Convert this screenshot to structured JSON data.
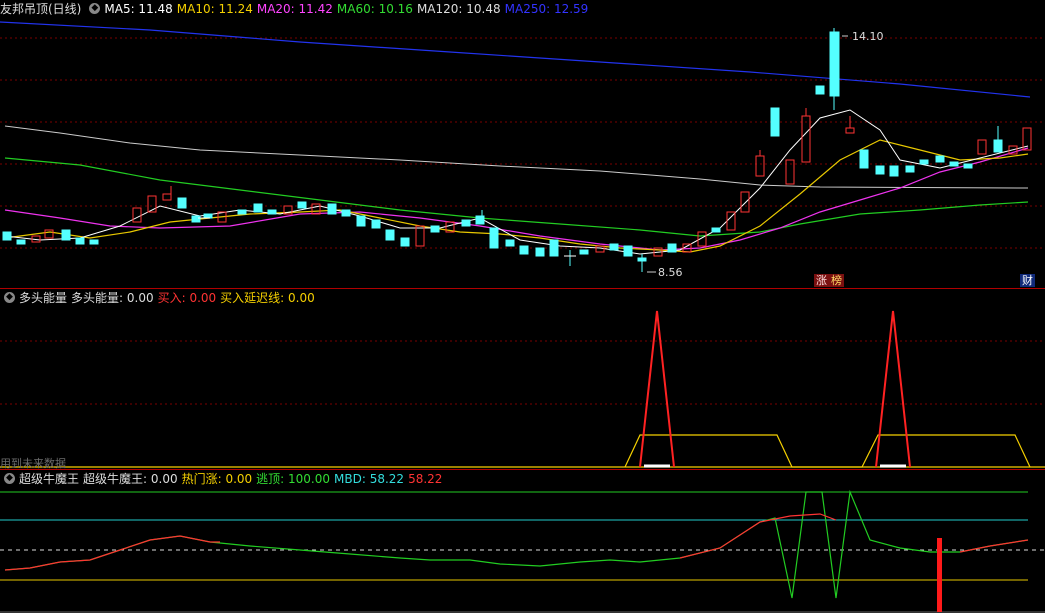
{
  "panel1": {
    "title": "友邦吊顶(日线)",
    "ma": [
      {
        "label": "MA5: 11.48",
        "color": "#ffffff"
      },
      {
        "label": "MA10: 11.24",
        "color": "#f5d000"
      },
      {
        "label": "MA20: 11.42",
        "color": "#ff44ff"
      },
      {
        "label": "MA60: 10.16",
        "color": "#33dd33"
      },
      {
        "label": "MA120: 10.48",
        "color": "#dddddd"
      },
      {
        "label": "MA250: 12.59",
        "color": "#3333ff"
      }
    ],
    "high_label": "14.10",
    "low_label": "8.56",
    "tags": {
      "zhang": "涨",
      "bang": "榜",
      "cai": "财"
    }
  },
  "panel2": {
    "name": "多头能量",
    "items": [
      {
        "label": "多头能量: 0.00",
        "color": "#dddddd"
      },
      {
        "label": "买入: 0.00",
        "color": "#ff3333"
      },
      {
        "label": "买入延迟线: 0.00",
        "color": "#f5d000"
      }
    ],
    "note": "用到未来数据"
  },
  "panel3": {
    "name": "超级牛魔王",
    "items": [
      {
        "label": "超级牛魔王: 0.00",
        "color": "#dddddd"
      },
      {
        "label": "热门涨: 0.00",
        "color": "#f5d000"
      },
      {
        "label": "逃顶: 100.00",
        "color": "#33dd33"
      },
      {
        "label": "MBD: 58.22",
        "color": "#33dddd"
      },
      {
        "label": "58.22",
        "color": "#ff3333"
      }
    ]
  }
}
